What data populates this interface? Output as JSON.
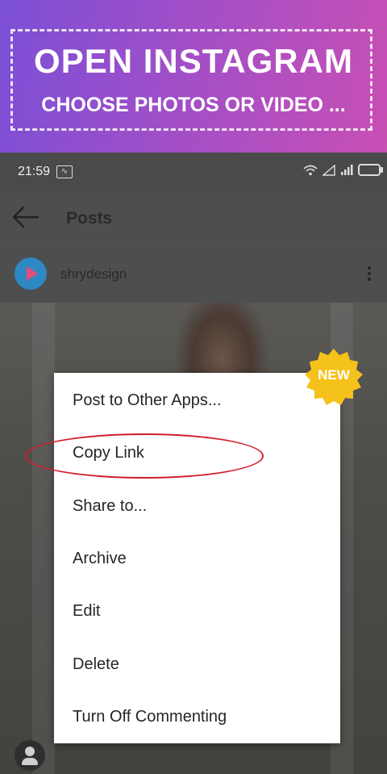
{
  "banner": {
    "title": "OPEN INSTAGRAM",
    "subtitle": "CHOOSE PHOTOS OR VIDEO ..."
  },
  "status_bar": {
    "time": "21:59",
    "icons": [
      "activity-icon",
      "wifi-icon",
      "signal-icon",
      "battery-icon"
    ]
  },
  "header": {
    "title": "Posts"
  },
  "post": {
    "username": "shrydesign"
  },
  "menu": {
    "items": [
      "Post to Other Apps...",
      "Copy Link",
      "Share to...",
      "Archive",
      "Edit",
      "Delete",
      "Turn Off Commenting"
    ],
    "highlighted": "Copy Link"
  },
  "badge": {
    "label": "NEW",
    "color": "#f5c21b"
  },
  "colors": {
    "highlight_ring": "#d11d2c",
    "banner_start": "#7b4fd6",
    "banner_end": "#c84fb4"
  }
}
